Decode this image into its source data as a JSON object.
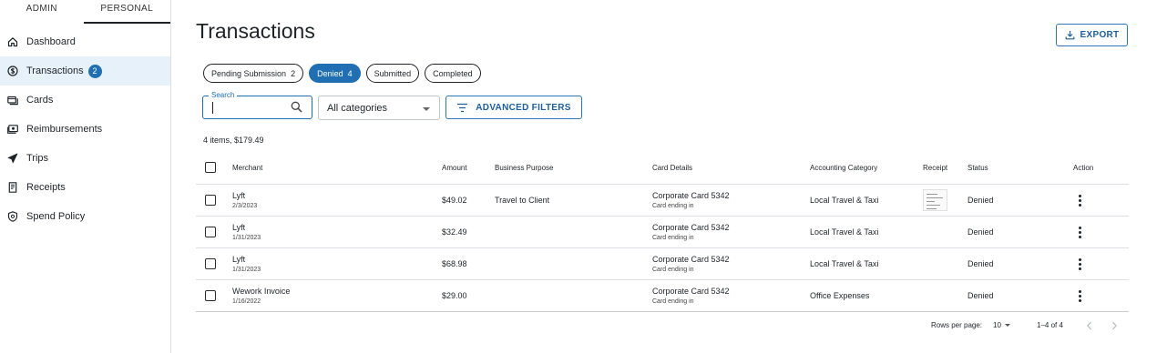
{
  "sidebar": {
    "role_tabs": [
      {
        "label": "ADMIN",
        "active": false
      },
      {
        "label": "PERSONAL",
        "active": true
      }
    ],
    "items": [
      {
        "label": "Dashboard",
        "icon": "home-icon",
        "active": false
      },
      {
        "label": "Transactions",
        "icon": "dollar-circle-icon",
        "active": true,
        "badge": "2"
      },
      {
        "label": "Cards",
        "icon": "cards-icon",
        "active": false
      },
      {
        "label": "Reimbursements",
        "icon": "cash-icon",
        "active": false
      },
      {
        "label": "Trips",
        "icon": "airplane-icon",
        "active": false
      },
      {
        "label": "Receipts",
        "icon": "receipt-icon",
        "active": false
      },
      {
        "label": "Spend Policy",
        "icon": "shield-icon",
        "active": false
      }
    ]
  },
  "header": {
    "title": "Transactions",
    "export_label": "EXPORT"
  },
  "chips": [
    {
      "label": "Pending Submission",
      "count": "2",
      "active": false
    },
    {
      "label": "Denied",
      "count": "4",
      "active": true
    },
    {
      "label": "Submitted",
      "count": "",
      "active": false
    },
    {
      "label": "Completed",
      "count": "",
      "active": false
    }
  ],
  "filters": {
    "search_label": "Search",
    "search_value": "",
    "category_value": "All categories",
    "advanced_label": "ADVANCED FILTERS"
  },
  "summary": "4 items, $179.49",
  "table": {
    "headers": {
      "merchant": "Merchant",
      "amount": "Amount",
      "purpose": "Business Purpose",
      "card": "Card Details",
      "acct": "Accounting Category",
      "receipt": "Receipt",
      "status": "Status",
      "action": "Action"
    },
    "rows": [
      {
        "merchant": "Lyft",
        "date": "2/3/2023",
        "amount": "$49.02",
        "purpose": "Travel to Client",
        "card": "Corporate Card 5342",
        "card_sub": "Card ending in",
        "acct": "Local Travel & Taxi",
        "has_receipt": true,
        "status": "Denied"
      },
      {
        "merchant": "Lyft",
        "date": "1/31/2023",
        "amount": "$32.49",
        "purpose": "",
        "card": "Corporate Card 5342",
        "card_sub": "Card ending in",
        "acct": "Local Travel & Taxi",
        "has_receipt": false,
        "status": "Denied"
      },
      {
        "merchant": "Lyft",
        "date": "1/31/2023",
        "amount": "$68.98",
        "purpose": "",
        "card": "Corporate Card 5342",
        "card_sub": "Card ending in",
        "acct": "Local Travel & Taxi",
        "has_receipt": false,
        "status": "Denied"
      },
      {
        "merchant": "Wework Invoice",
        "date": "1/16/2022",
        "amount": "$29.00",
        "purpose": "",
        "card": "Corporate Card 5342",
        "card_sub": "Card ending in",
        "acct": "Office Expenses",
        "has_receipt": false,
        "status": "Denied"
      }
    ]
  },
  "pagination": {
    "rows_per_page_label": "Rows per page:",
    "rows_per_page_value": "10",
    "range": "1–4 of 4"
  },
  "colors": {
    "accent": "#1f6fb2",
    "active_nav_bg": "#e6f1f9",
    "border": "#dcdfe3"
  }
}
